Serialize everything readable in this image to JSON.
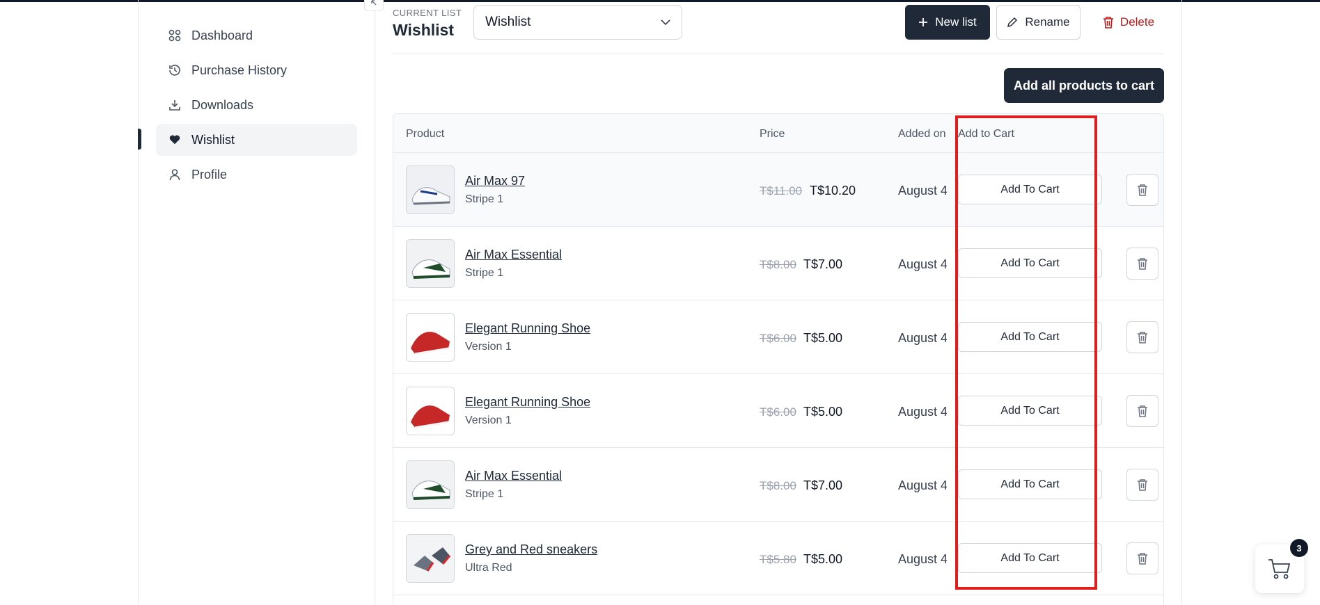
{
  "sidebar": {
    "items": [
      {
        "label": "Dashboard",
        "icon": "grid-icon"
      },
      {
        "label": "Purchase History",
        "icon": "history-icon"
      },
      {
        "label": "Downloads",
        "icon": "download-icon"
      },
      {
        "label": "Wishlist",
        "icon": "heart-icon",
        "active": true
      },
      {
        "label": "Profile",
        "icon": "user-icon"
      }
    ]
  },
  "header": {
    "current_label": "CURRENT LIST",
    "current_title": "Wishlist",
    "select_value": "Wishlist",
    "new_list": "New list",
    "rename": "Rename",
    "delete": "Delete",
    "add_all": "Add all products to cart"
  },
  "table": {
    "columns": [
      "Product",
      "Price",
      "Added on",
      "Add to Cart"
    ],
    "rows": [
      {
        "name": "Air Max 97",
        "variant": "Stripe 1",
        "old_price": "T$11.00",
        "price": "T$10.20",
        "added": "August 4",
        "action": "Add To Cart",
        "image": "white-blue-sneaker"
      },
      {
        "name": "Air Max Essential",
        "variant": "Stripe 1",
        "old_price": "T$8.00",
        "price": "T$7.00",
        "added": "August 4",
        "action": "Add To Cart",
        "image": "white-green-sneaker"
      },
      {
        "name": "Elegant Running Shoe",
        "variant": "Version 1",
        "old_price": "T$6.00",
        "price": "T$5.00",
        "added": "August 4",
        "action": "Add To Cart",
        "image": "red-running-shoe"
      },
      {
        "name": "Elegant Running Shoe",
        "variant": "Version 1",
        "old_price": "T$6.00",
        "price": "T$5.00",
        "added": "August 4",
        "action": "Add To Cart",
        "image": "red-running-shoe"
      },
      {
        "name": "Air Max Essential",
        "variant": "Stripe 1",
        "old_price": "T$8.00",
        "price": "T$7.00",
        "added": "August 4",
        "action": "Add To Cart",
        "image": "white-green-sneaker"
      },
      {
        "name": "Grey and Red sneakers",
        "variant": "Ultra Red",
        "old_price": "T$5.80",
        "price": "T$5.00",
        "added": "August 4",
        "action": "Add To Cart",
        "image": "grey-red-sneakers"
      }
    ]
  },
  "cart": {
    "count": "3"
  },
  "colors": {
    "primary": "#1f2937",
    "danger": "#b91c1c",
    "highlight": "#e11d1d"
  }
}
